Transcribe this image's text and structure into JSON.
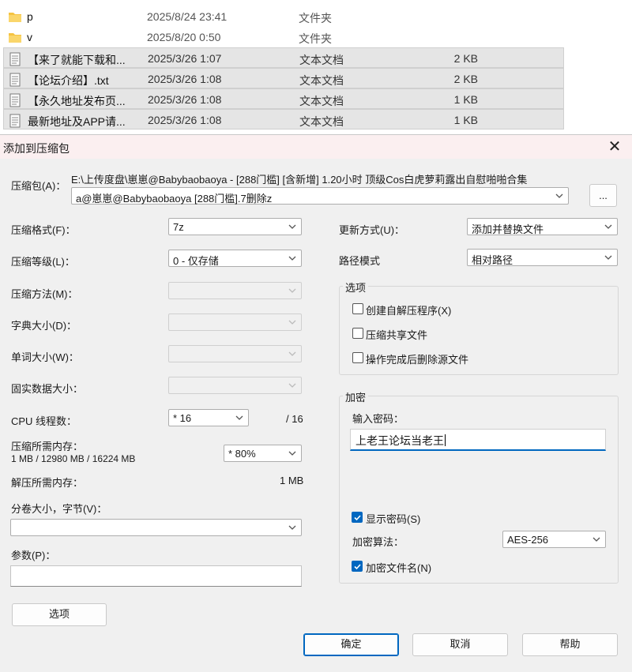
{
  "files": [
    {
      "icon": "folder-icon",
      "name": "p",
      "date": "2025/8/24 23:41",
      "type": "文件夹",
      "size": "",
      "selected": false
    },
    {
      "icon": "folder-icon",
      "name": "v",
      "date": "2025/8/20 0:50",
      "type": "文件夹",
      "size": "",
      "selected": false
    },
    {
      "icon": "text-file-icon",
      "name": "【来了就能下载和...",
      "date": "2025/3/26 1:07",
      "type": "文本文档",
      "size": "2 KB",
      "selected": true
    },
    {
      "icon": "text-file-icon",
      "name": "【论坛介绍】.txt",
      "date": "2025/3/26 1:08",
      "type": "文本文档",
      "size": "2 KB",
      "selected": true
    },
    {
      "icon": "text-file-icon",
      "name": "【永久地址发布页...",
      "date": "2025/3/26 1:08",
      "type": "文本文档",
      "size": "1 KB",
      "selected": true
    },
    {
      "icon": "text-file-icon",
      "name": "最新地址及APP请...",
      "date": "2025/3/26 1:08",
      "type": "文本文档",
      "size": "1 KB",
      "selected": true
    }
  ],
  "dialog": {
    "title": "添加到压缩包",
    "close_label": "✕",
    "archive": {
      "label": "压缩包(A)：",
      "path": "E:\\上传度盘\\崽崽@Babybaobaoya - [288门槛] [含新增] 1.20小时 顶级Cos白虎萝莉露出自慰啪啪合集",
      "name": "a@崽崽@Babybaobaoya [288门槛].7删除z",
      "browse_label": "..."
    },
    "left": {
      "format_label": "压缩格式(F)：",
      "format_value": "7z",
      "level_label": "压缩等级(L)：",
      "level_value": "0 - 仅存储",
      "method_label": "压缩方法(M)：",
      "dict_label": "字典大小(D)：",
      "word_label": "单词大小(W)：",
      "solid_label": "固实数据大小：",
      "cpu_label": "CPU 线程数：",
      "cpu_value": "* 16",
      "cpu_max": "/ 16",
      "mem_label": "压缩所需内存：",
      "mem_detail": "1 MB / 12980 MB / 16224 MB",
      "mem_value": "* 80%",
      "decomp_label": "解压所需内存：",
      "decomp_value": "1 MB",
      "volume_label": "分卷大小，字节(V)：",
      "params_label": "参数(P)：",
      "options_button": "选项"
    },
    "right": {
      "update_label": "更新方式(U)：",
      "update_value": "添加并替换文件",
      "path_label": "路径模式",
      "path_value": "相对路径",
      "options_title": "选项",
      "opt_sfx": "创建自解压程序(X)",
      "opt_shared": "压缩共享文件",
      "opt_delete": "操作完成后删除源文件",
      "encrypt_title": "加密",
      "password_label": "输入密码：",
      "password_value": "上老王论坛当老王",
      "show_password": "显示密码(S)",
      "method_label": "加密算法：",
      "method_value": "AES-256",
      "encrypt_names": "加密文件名(N)"
    },
    "buttons": {
      "ok": "确定",
      "cancel": "取消",
      "help": "帮助"
    }
  },
  "colors": {
    "accent": "#0067c0",
    "folder": "#f5c342",
    "titlebar": "#fbeff0",
    "dialog_bg": "#f0f0f0"
  }
}
